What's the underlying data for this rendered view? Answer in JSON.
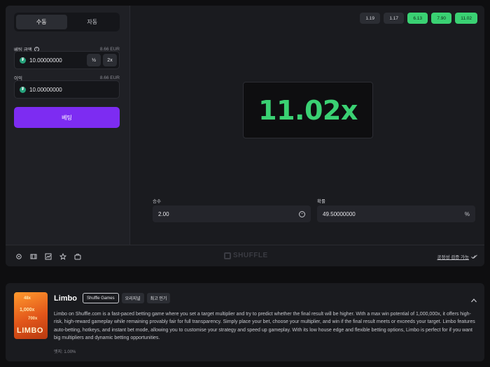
{
  "mode_toggle": {
    "manual": "수동",
    "auto": "자동"
  },
  "bet_amount": {
    "label": "베팅 금액",
    "converted": "8.66 EUR",
    "value": "10.00000000",
    "half_label": "½",
    "double_label": "2x"
  },
  "profit": {
    "label": "이익",
    "converted": "8.66 EUR",
    "value": "10.00000000"
  },
  "bet_button": {
    "label": "베팅"
  },
  "history": [
    {
      "value": "1.19",
      "win": false
    },
    {
      "value": "1.17",
      "win": false
    },
    {
      "value": "6.13",
      "win": true
    },
    {
      "value": "7.90",
      "win": true
    },
    {
      "value": "11.02",
      "win": true
    }
  ],
  "result": {
    "value": "11.02x",
    "color": "#3ad173"
  },
  "multiplier": {
    "label": "승수",
    "value": "2.00"
  },
  "win_chance": {
    "label": "확률",
    "value": "49.50000000",
    "unit": "%"
  },
  "footer": {
    "brand": "SHUFFLE",
    "fairness_link": "공정성 검증 가능"
  },
  "game_info": {
    "title": "Limbo",
    "tags": [
      "Shuffle Games",
      "오리지널",
      "최고 인기"
    ],
    "thumb": {
      "mult1": "48x",
      "mult2": "1,000x",
      "mult3": "700x",
      "logo": "LIMBO"
    },
    "description": "Limbo on Shuffle.com is a fast-paced betting game where you set a target multiplier and try to predict whether the final result will be higher. With a max win potential of 1,000,000x, it offers high-risk, high-reward gameplay while remaining provably fair for full transparency. Simply place your bet, choose your multiplier, and win if the final result meets or exceeds your target. Limbo features auto-betting, hotkeys, and instant bet mode, allowing you to customise your strategy and speed up gameplay. With its low house edge and flexible betting options, Limbo is perfect for if you want big multipliers and dynamic betting opportunities.",
    "house_edge": "엣지: 1.00%"
  },
  "colors": {
    "accent": "#7d2cf2",
    "win": "#3ad173",
    "panel": "#1f2025",
    "background": "#0e0e10"
  }
}
